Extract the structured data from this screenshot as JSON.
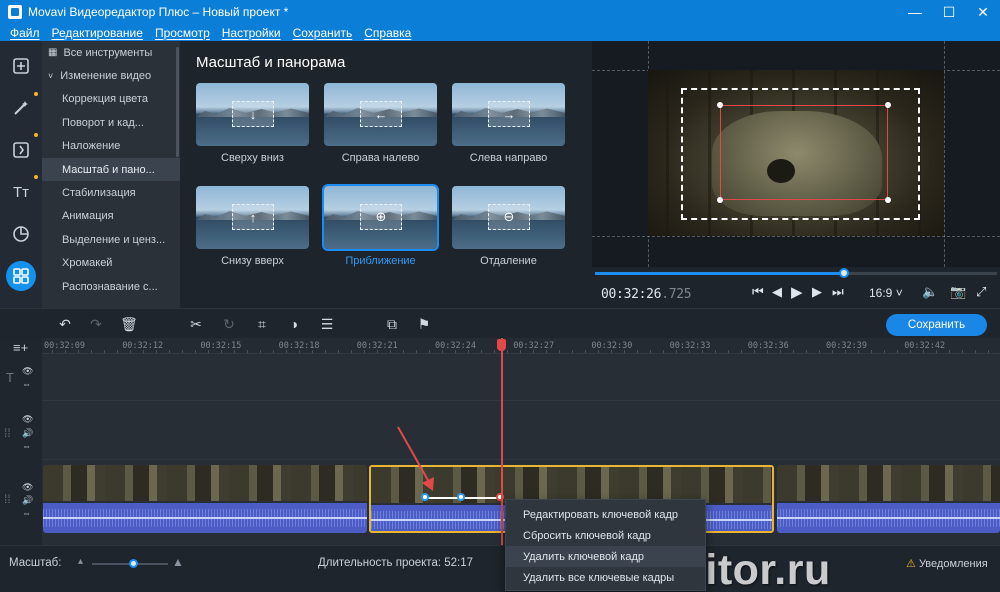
{
  "window": {
    "title": "Movavi Видеоредактор Плюс – Новый проект *",
    "controls": {
      "minimize": "—",
      "maximize": "☐",
      "close": "✕"
    }
  },
  "menu": [
    "Файл",
    "Редактирование",
    "Просмотр",
    "Настройки",
    "Сохранить",
    "Справка"
  ],
  "rail": {
    "items": [
      {
        "name": "import-icon"
      },
      {
        "name": "filters-icon"
      },
      {
        "name": "transitions-icon"
      },
      {
        "name": "titles-icon",
        "label": "Tт"
      },
      {
        "name": "stickers-icon"
      },
      {
        "name": "more-tools-icon"
      }
    ],
    "accent": "#1292ee"
  },
  "categories": {
    "all_tools": "Все инструменты",
    "change_video": "Изменение видео",
    "items": [
      "Коррекция цвета",
      "Поворот и кад...",
      "Наложение",
      "Масштаб и пано...",
      "Стабилизация",
      "Анимация",
      "Выделение и ценз...",
      "Хромакей",
      "Распознавание с..."
    ],
    "selected_index": 3
  },
  "gallery": {
    "heading": "Масштаб и панорама",
    "effects": [
      {
        "label": "Сверху вниз",
        "glyph": "↓"
      },
      {
        "label": "Справа налево",
        "glyph": "←"
      },
      {
        "label": "Слева направо",
        "glyph": "→"
      },
      {
        "label": "Снизу вверх",
        "glyph": "↑"
      },
      {
        "label": "Приближение",
        "glyph": "⊕"
      },
      {
        "label": "Отдаление",
        "glyph": "⊖"
      }
    ],
    "selected_index": 4
  },
  "player": {
    "time_main": "00:32:26",
    "time_ms": ".725",
    "aspect_ratio": "16:9 ˅",
    "progress_fraction": 0.62
  },
  "toolbar": {
    "save_label": "Сохранить"
  },
  "timeline": {
    "ruler_ticks": [
      "00:32:09",
      "00:32:12",
      "00:32:15",
      "00:32:18",
      "00:32:21",
      "00:32:24",
      "00:32:27",
      "00:32:30",
      "00:32:33",
      "00:32:36",
      "00:32:39",
      "00:32:42"
    ],
    "selection_color": "#e9b533",
    "playhead_color": "#e14848"
  },
  "context_menu": {
    "items": [
      "Редактировать ключевой кадр",
      "Сбросить ключевой кадр",
      "Удалить ключевой кадр",
      "Удалить все ключевые кадры"
    ],
    "hover_index": 2
  },
  "status": {
    "zoom_label": "Масштаб:",
    "duration": "Длительность проекта:  52:17",
    "notifications": "Уведомления"
  },
  "watermark": "movavieditor.ru"
}
